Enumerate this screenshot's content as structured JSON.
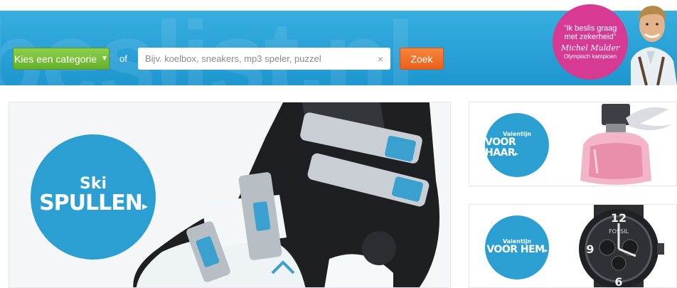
{
  "header": {
    "watermark": "beslist.nl",
    "category_button": "Kies een categorie",
    "category_arrow": "▼",
    "or_label": "of",
    "search_placeholder": "Bijv. koelbox, sneakers, mp3 speler, puzzel",
    "search_value": "",
    "clear_icon": "×",
    "search_button": "Zoek"
  },
  "promo": {
    "quote_line1": "\"Ik beslis graag",
    "quote_line2": "met zekerheid\"",
    "signature": "Michel Mulder",
    "subtitle": "Olympisch kampioen"
  },
  "main_banner": {
    "line1": "Ski",
    "line2": "SPULLEN",
    "arrow": "▸",
    "accent": "#2b9fd1"
  },
  "cards": [
    {
      "line1": "Valentijn",
      "line2": "VOOR HAAR",
      "arrow": "▸",
      "product_icon": "perfume-bottle-icon"
    },
    {
      "line1": "Valentijn",
      "line2": "VOOR HEM",
      "arrow": "▸",
      "product_icon": "wristwatch-icon",
      "watch_brand": "FOSSIL"
    }
  ],
  "colors": {
    "header_blue": "#1e96cf",
    "green_button": "#66b02c",
    "orange_button": "#e9601b",
    "promo_pink": "#d63a93"
  }
}
